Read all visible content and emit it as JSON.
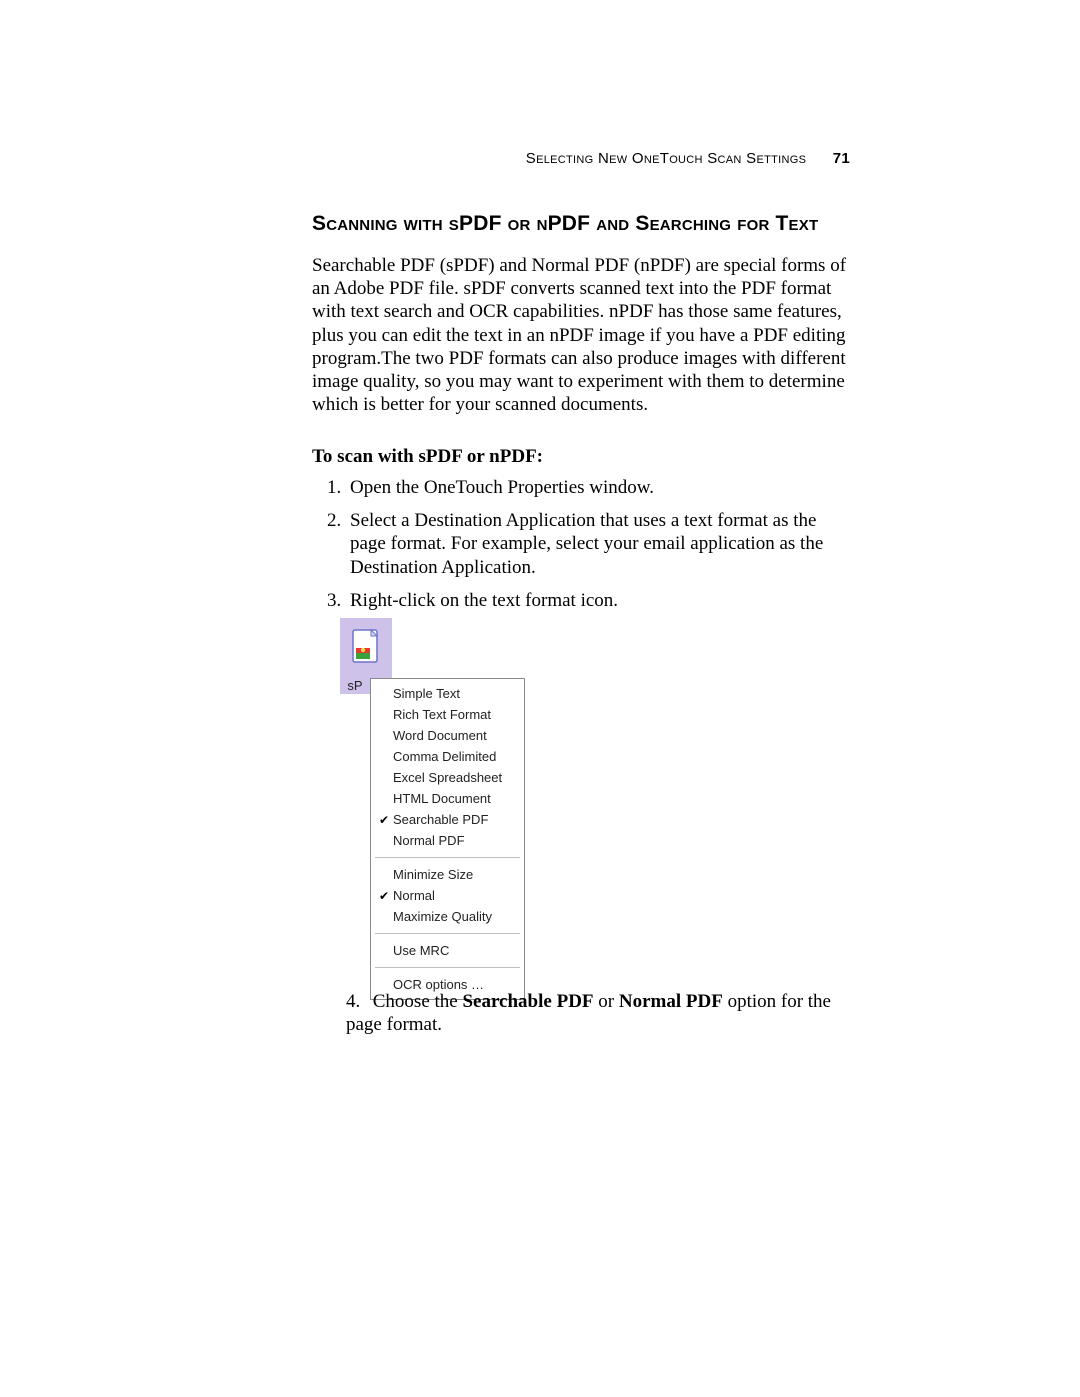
{
  "header": {
    "running_head": "Selecting New OneTouch Scan Settings",
    "page_number": "71"
  },
  "heading": "Scanning with sPDF or nPDF and Searching for Text",
  "intro_paragraph": "Searchable PDF (sPDF) and Normal PDF (nPDF) are special forms of an Adobe PDF file. sPDF converts scanned text into the PDF format with text search and OCR capabilities. nPDF has those same features, plus you can edit the text in an nPDF image if you have a PDF editing program.The two PDF formats can also produce images with different image quality, so you may want to experiment with them to determine which is better for your scanned documents.",
  "subheading": "To scan with sPDF or nPDF:",
  "steps": {
    "s1": "Open the OneTouch Properties window.",
    "s2": "Select a Destination Application that uses a text format as the page format. For example, select your email application as the Destination Application.",
    "s3": "Right-click on the text format icon.",
    "s4_pre": "Choose the ",
    "s4_b1": "Searchable PDF",
    "s4_mid": " or ",
    "s4_b2": "Normal PDF",
    "s4_post": " option for the page format."
  },
  "figure": {
    "icon_label": "sP",
    "menu": {
      "group1": [
        {
          "label": "Simple Text",
          "checked": false
        },
        {
          "label": "Rich Text Format",
          "checked": false
        },
        {
          "label": "Word Document",
          "checked": false
        },
        {
          "label": "Comma Delimited",
          "checked": false
        },
        {
          "label": "Excel Spreadsheet",
          "checked": false
        },
        {
          "label": "HTML Document",
          "checked": false
        },
        {
          "label": "Searchable PDF",
          "checked": true
        },
        {
          "label": "Normal PDF",
          "checked": false
        }
      ],
      "group2": [
        {
          "label": "Minimize Size",
          "checked": false
        },
        {
          "label": "Normal",
          "checked": true
        },
        {
          "label": "Maximize Quality",
          "checked": false
        }
      ],
      "group3": [
        {
          "label": "Use MRC",
          "checked": false
        }
      ],
      "group4": [
        {
          "label": "OCR options …",
          "checked": false
        }
      ]
    }
  }
}
